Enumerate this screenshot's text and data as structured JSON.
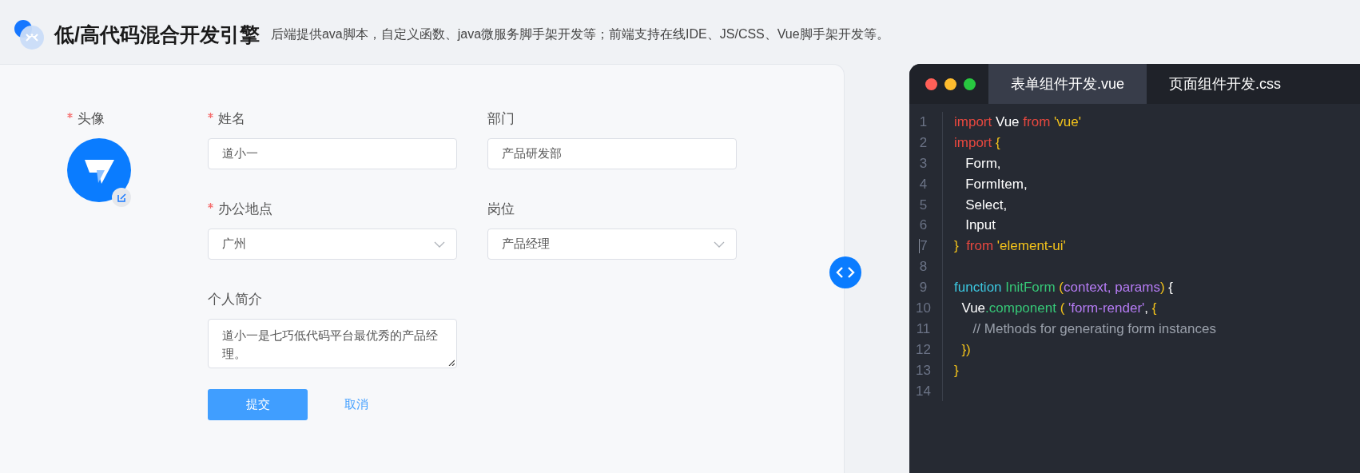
{
  "header": {
    "title": "低/高代码混合开发引擎",
    "subtitle": "后端提供ava脚本，自定义函数、java微服务脚手架开发等；前端支持在线IDE、JS/CSS、Vue脚手架开发等。"
  },
  "form": {
    "avatar": {
      "label": "头像",
      "required": true
    },
    "fields": [
      {
        "label": "姓名",
        "required": true,
        "kind": "text",
        "value": "道小一"
      },
      {
        "label": "部门",
        "required": false,
        "kind": "text",
        "value": "产品研发部"
      },
      {
        "label": "办公地点",
        "required": true,
        "kind": "select",
        "value": "广州"
      },
      {
        "label": "岗位",
        "required": false,
        "kind": "select",
        "value": "产品经理"
      },
      {
        "label": "个人简介",
        "required": false,
        "kind": "textarea",
        "value": "道小一是七巧低代码平台最优秀的产品经理。"
      }
    ],
    "buttons": [
      {
        "label": "提交",
        "kind": "primary"
      },
      {
        "label": "取消",
        "kind": "link"
      }
    ]
  },
  "editor": {
    "tabs": [
      {
        "label": "表单组件开发.vue",
        "selected": true
      },
      {
        "label": "页面组件开发.css",
        "selected": false
      }
    ],
    "lines": [
      {
        "number": "1",
        "cursor": false,
        "tokens": [
          {
            "text": "import",
            "kind": "keyword"
          },
          {
            "text": " Vue ",
            "kind": "plain"
          },
          {
            "text": "from",
            "kind": "keyword"
          },
          {
            "text": " 'vue'",
            "kind": "string"
          }
        ]
      },
      {
        "number": "2",
        "cursor": false,
        "tokens": [
          {
            "text": "import",
            "kind": "keyword"
          },
          {
            "text": " {",
            "kind": "punct"
          }
        ]
      },
      {
        "number": "3",
        "cursor": false,
        "tokens": [
          {
            "text": "   Form,",
            "kind": "plain"
          }
        ]
      },
      {
        "number": "4",
        "cursor": false,
        "tokens": [
          {
            "text": "   FormItem,",
            "kind": "plain"
          }
        ]
      },
      {
        "number": "5",
        "cursor": false,
        "tokens": [
          {
            "text": "   Select,",
            "kind": "plain"
          }
        ]
      },
      {
        "number": "6",
        "cursor": false,
        "tokens": [
          {
            "text": "   Input",
            "kind": "plain"
          }
        ]
      },
      {
        "number": "7",
        "cursor": true,
        "tokens": [
          {
            "text": "}  ",
            "kind": "punct"
          },
          {
            "text": "from",
            "kind": "keyword"
          },
          {
            "text": " 'element-ui'",
            "kind": "string"
          }
        ]
      },
      {
        "number": "8",
        "cursor": false
      },
      {
        "number": "9",
        "cursor": false,
        "tokens": [
          {
            "text": "function",
            "kind": "fnkeyword"
          },
          {
            "text": " InitForm ",
            "kind": "name"
          },
          {
            "text": "(",
            "kind": "punct"
          },
          {
            "text": "context, params",
            "kind": "param"
          },
          {
            "text": ")",
            "kind": "punct"
          },
          {
            "text": " {",
            "kind": "plain"
          }
        ]
      },
      {
        "number": "10",
        "cursor": false,
        "tokens": [
          {
            "text": "  Vue",
            "kind": "plain"
          },
          {
            "text": ".component ",
            "kind": "name"
          },
          {
            "text": "( ",
            "kind": "punct"
          },
          {
            "text": "'form-render'",
            "kind": "param"
          },
          {
            "text": ", ",
            "kind": "plain"
          },
          {
            "text": "{",
            "kind": "punct"
          }
        ]
      },
      {
        "number": "11",
        "cursor": false,
        "tokens": [
          {
            "text": "     // Methods for generating form instances",
            "kind": "comment"
          }
        ]
      },
      {
        "number": "12",
        "cursor": false,
        "tokens": [
          {
            "text": "  })",
            "kind": "punct"
          }
        ]
      },
      {
        "number": "13",
        "cursor": false,
        "tokens": [
          {
            "text": "}",
            "kind": "punct"
          }
        ]
      },
      {
        "number": "14",
        "cursor": false
      }
    ]
  }
}
